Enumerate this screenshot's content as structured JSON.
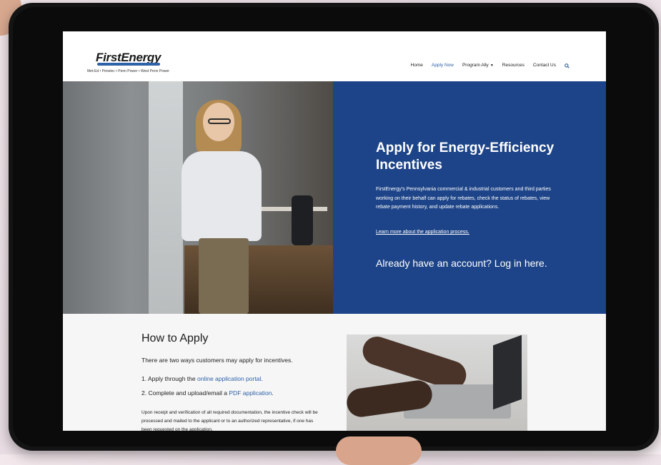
{
  "logo": {
    "name": "FirstEnergy",
    "tagline": "Met-Ed • Penelec • Penn Power • West Penn Power"
  },
  "nav": {
    "items": [
      "Home",
      "Apply Now",
      "Program Ally",
      "Resources",
      "Contact Us"
    ],
    "active": "Apply Now",
    "search_icon": "search-icon"
  },
  "hero": {
    "title": "Apply for Energy-Efficiency Incentives",
    "description": "FirstEnergy's Pennsylvania commercial & industrial customers and third parties working on their behalf can apply for rebates, check the status of rebates, view rebate payment history, and update rebate applications.",
    "learn_link": "Learn more about the application process.",
    "login_link": "Already have an account? Log in here."
  },
  "how_to_apply": {
    "heading": "How to Apply",
    "intro": "There are two ways customers may apply for incentives.",
    "step1_prefix": "1. Apply through the ",
    "step1_link": "online application portal",
    "step1_suffix": ".",
    "step2_prefix": "2. Complete and upload/email a ",
    "step2_link": "PDF application",
    "step2_suffix": ".",
    "note": "Upon receipt and verification of all required documentation, the incentive check will be processed and mailed to the applicant or to an authorized representative, if one has been requested on the application."
  },
  "colors": {
    "brand_blue": "#1d4488",
    "link_blue": "#2d61a8"
  }
}
